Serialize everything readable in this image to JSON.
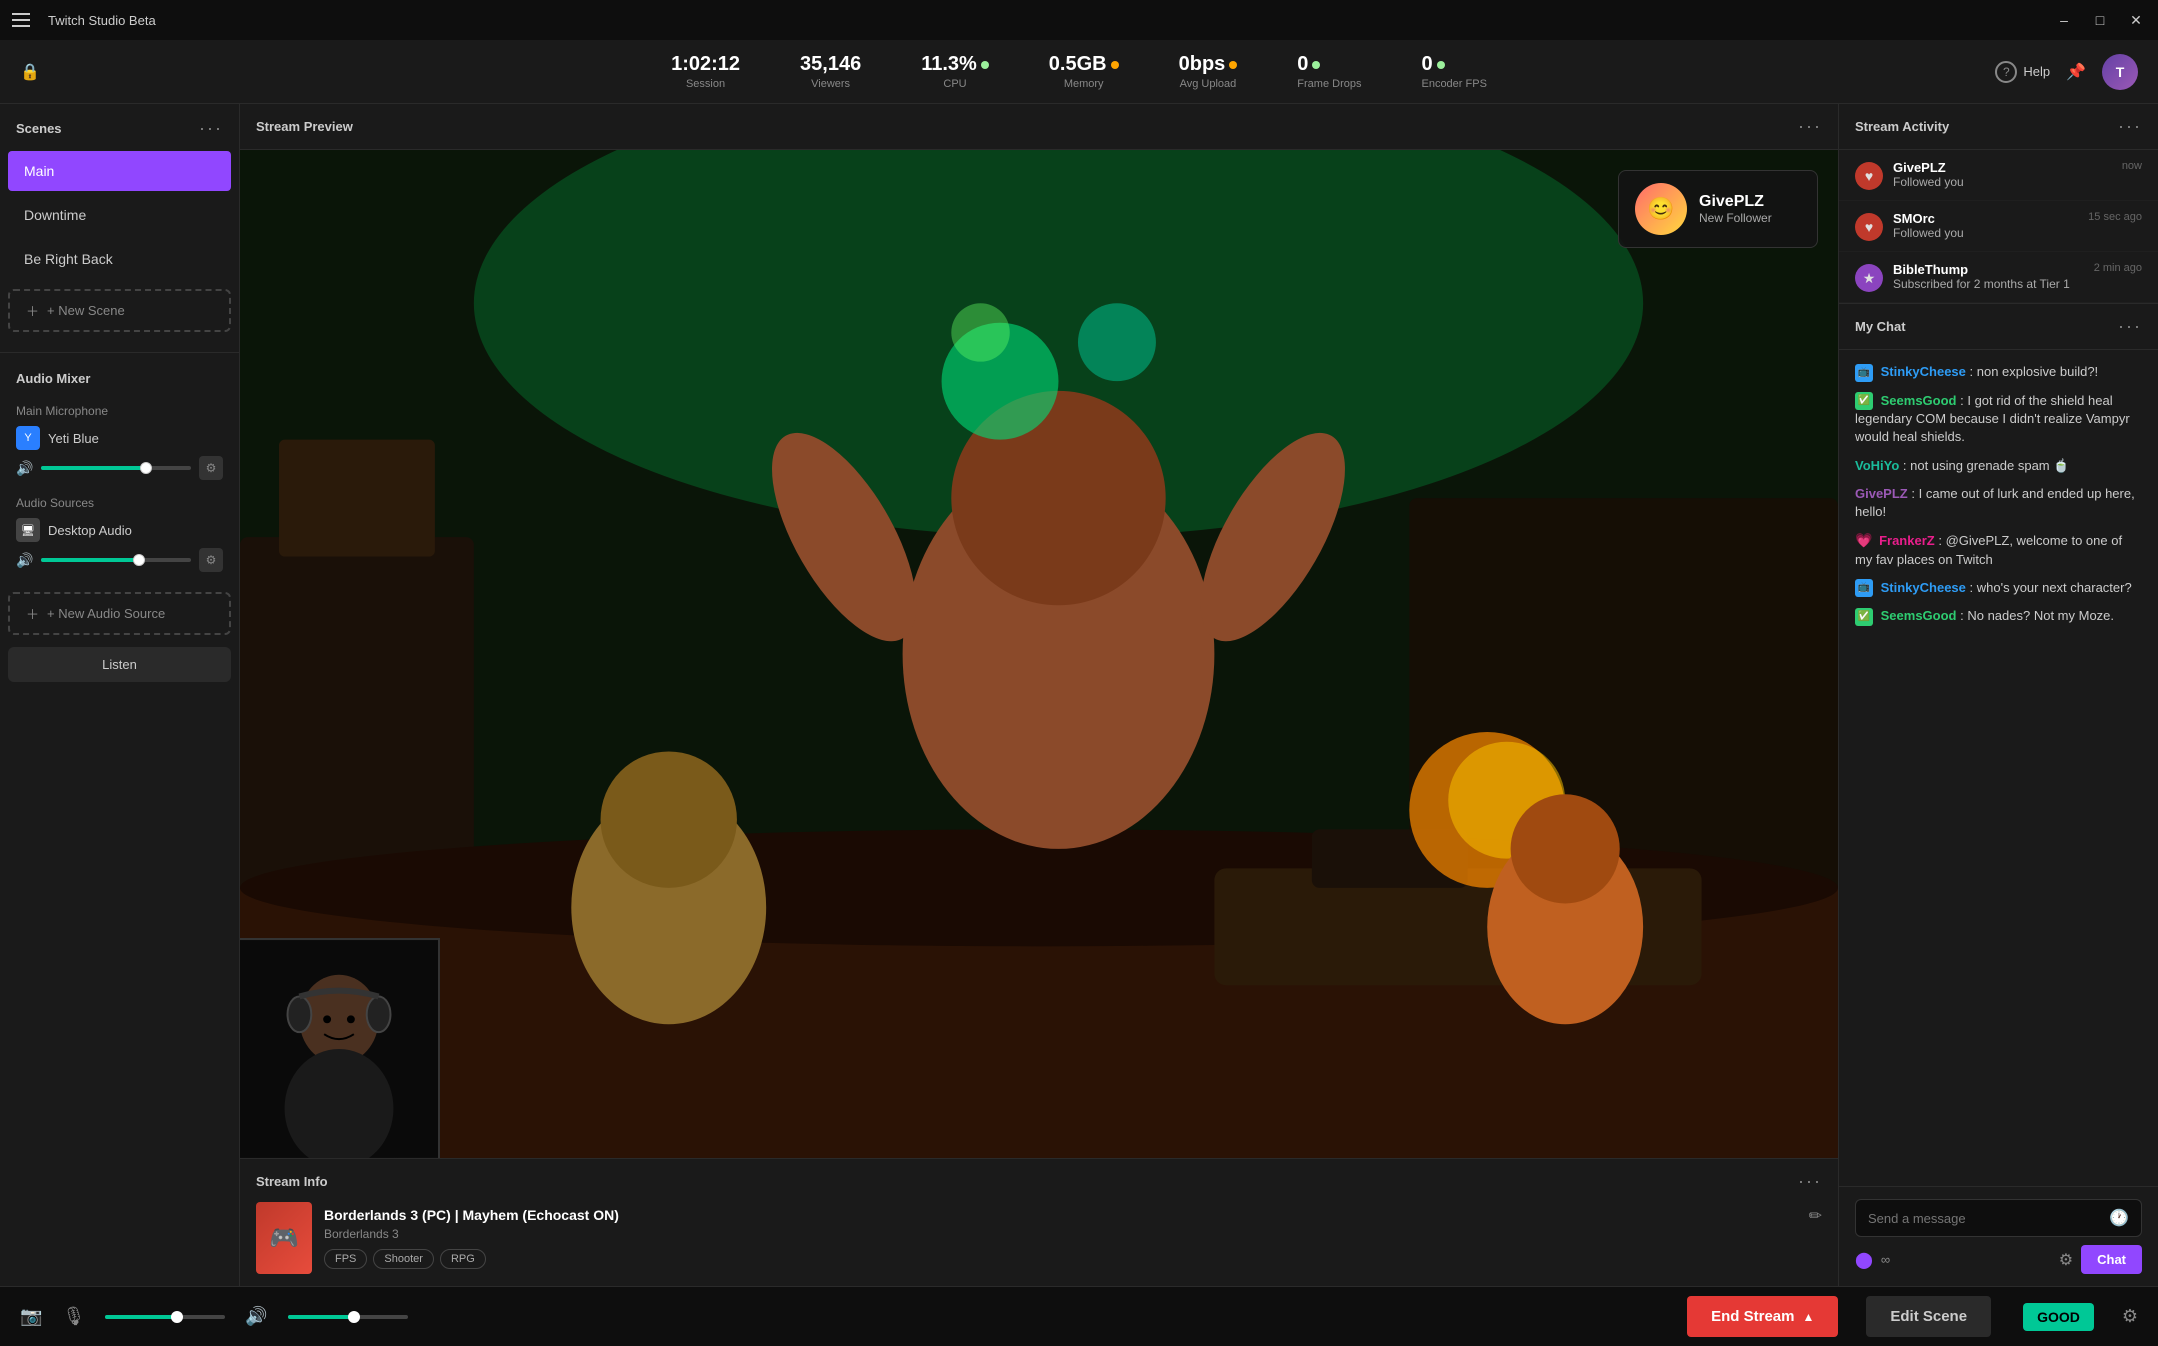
{
  "app": {
    "title": "Twitch Studio Beta"
  },
  "titlebar": {
    "minimize": "–",
    "maximize": "□",
    "close": "✕"
  },
  "stats": {
    "session": {
      "value": "1:02:12",
      "label": "Session"
    },
    "viewers": {
      "value": "35,146",
      "label": "Viewers"
    },
    "cpu": {
      "value": "11.3%",
      "label": "CPU",
      "dot": true
    },
    "memory": {
      "value": "0.5GB",
      "label": "Memory",
      "dot": true,
      "dot_color": "orange"
    },
    "avgUpload": {
      "value": "0bps",
      "label": "Avg Upload",
      "dot": true,
      "dot_color": "orange"
    },
    "frameDrops": {
      "value": "0",
      "label": "Frame Drops",
      "dot": true
    },
    "encoderFPS": {
      "value": "0",
      "label": "Encoder FPS",
      "dot": true
    }
  },
  "help": {
    "label": "Help"
  },
  "scenes": {
    "title": "Scenes",
    "items": [
      {
        "name": "Main",
        "active": true
      },
      {
        "name": "Downtime",
        "active": false
      },
      {
        "name": "Be Right Back",
        "active": false
      }
    ],
    "new_label": "+ New Scene"
  },
  "audio_mixer": {
    "title": "Audio Mixer",
    "microphone": {
      "section": "Main Microphone",
      "device_name": "Yeti Blue",
      "volume": 70
    },
    "sources": {
      "section": "Audio Sources",
      "device_name": "Desktop Audio",
      "volume": 65
    },
    "new_label": "+ New Audio Source",
    "listen_label": "Listen"
  },
  "preview": {
    "title": "Stream Preview",
    "follower_popup": {
      "name": "GivePLZ",
      "action": "New Follower"
    }
  },
  "stream_info": {
    "title": "Stream Info",
    "game_title": "Borderlands 3 (PC) | Mayhem (Echocast ON)",
    "game_name": "Borderlands 3",
    "tags": [
      "FPS",
      "Shooter",
      "RPG"
    ]
  },
  "stream_activity": {
    "title": "Stream Activity",
    "items": [
      {
        "name": "GivePLZ",
        "action": "Followed you",
        "time": "now",
        "icon": "♥",
        "type": "heart"
      },
      {
        "name": "SMOrc",
        "action": "Followed you",
        "time": "15 sec ago",
        "icon": "♥",
        "type": "heart"
      },
      {
        "name": "BibleThump",
        "action": "Subscribed for 2 months at Tier 1",
        "time": "2 min ago",
        "icon": "★",
        "type": "star"
      }
    ]
  },
  "chat": {
    "title": "My Chat",
    "messages": [
      {
        "user": "StinkyCheese",
        "color": "blue",
        "badge": "🟦",
        "text": "non explosive build?!"
      },
      {
        "user": "SeemsGood",
        "color": "green",
        "badge": "✅",
        "text": "I got rid of the shield heal legendary COM because I didn't realize Vampyr would heal shields."
      },
      {
        "user": "VoHiYo",
        "color": "teal",
        "badge": "",
        "text": "not using grenade spam 🍵"
      },
      {
        "user": "GivePLZ",
        "color": "purple",
        "badge": "",
        "text": "I came out of lurk and ended up here, hello!"
      },
      {
        "user": "FrankerZ",
        "color": "pink",
        "badge": "💗",
        "text": "@GivePLZ, welcome to one of my fav places on Twitch"
      },
      {
        "user": "StinkyCheese",
        "color": "blue",
        "badge": "🟦",
        "text": "who's your next character?"
      },
      {
        "user": "SeemsGood",
        "color": "green",
        "badge": "✅",
        "text": "No nades? Not my Moze."
      }
    ],
    "input_placeholder": "Send a message",
    "send_label": "Chat",
    "infinity_count": "∞"
  },
  "bottom_bar": {
    "end_stream_label": "End Stream",
    "edit_scene_label": "Edit Scene",
    "good_label": "GOOD",
    "mic_volume": 60,
    "speaker_volume": 55
  }
}
